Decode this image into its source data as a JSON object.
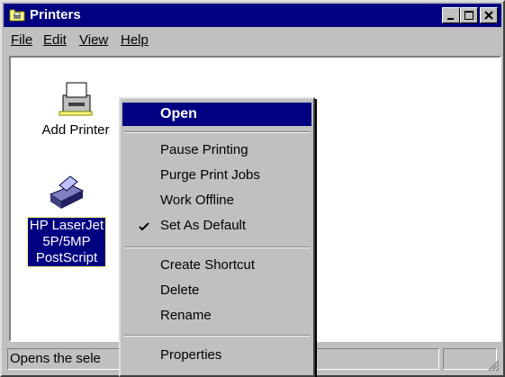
{
  "window": {
    "title": "Printers"
  },
  "menubar": {
    "file": "File",
    "edit": "Edit",
    "view": "View",
    "help": "Help"
  },
  "icons": [
    {
      "label": "Add Printer",
      "icon": "add-printer-icon"
    },
    {
      "label_lines": [
        "HP LaserJet",
        "5P/5MP",
        "PostScript"
      ],
      "icon": "printer-icon",
      "selected": true
    }
  ],
  "context_menu": {
    "open": "Open",
    "pause": "Pause Printing",
    "purge": "Purge Print Jobs",
    "offline": "Work Offline",
    "default": "Set As Default",
    "default_checked": true,
    "shortcut": "Create Shortcut",
    "delete": "Delete",
    "rename": "Rename",
    "properties": "Properties"
  },
  "statusbar": {
    "text": "Opens the sele"
  },
  "colors": {
    "titlebar": "#000080",
    "face": "#c0c0c0",
    "highlight": "#000080"
  }
}
